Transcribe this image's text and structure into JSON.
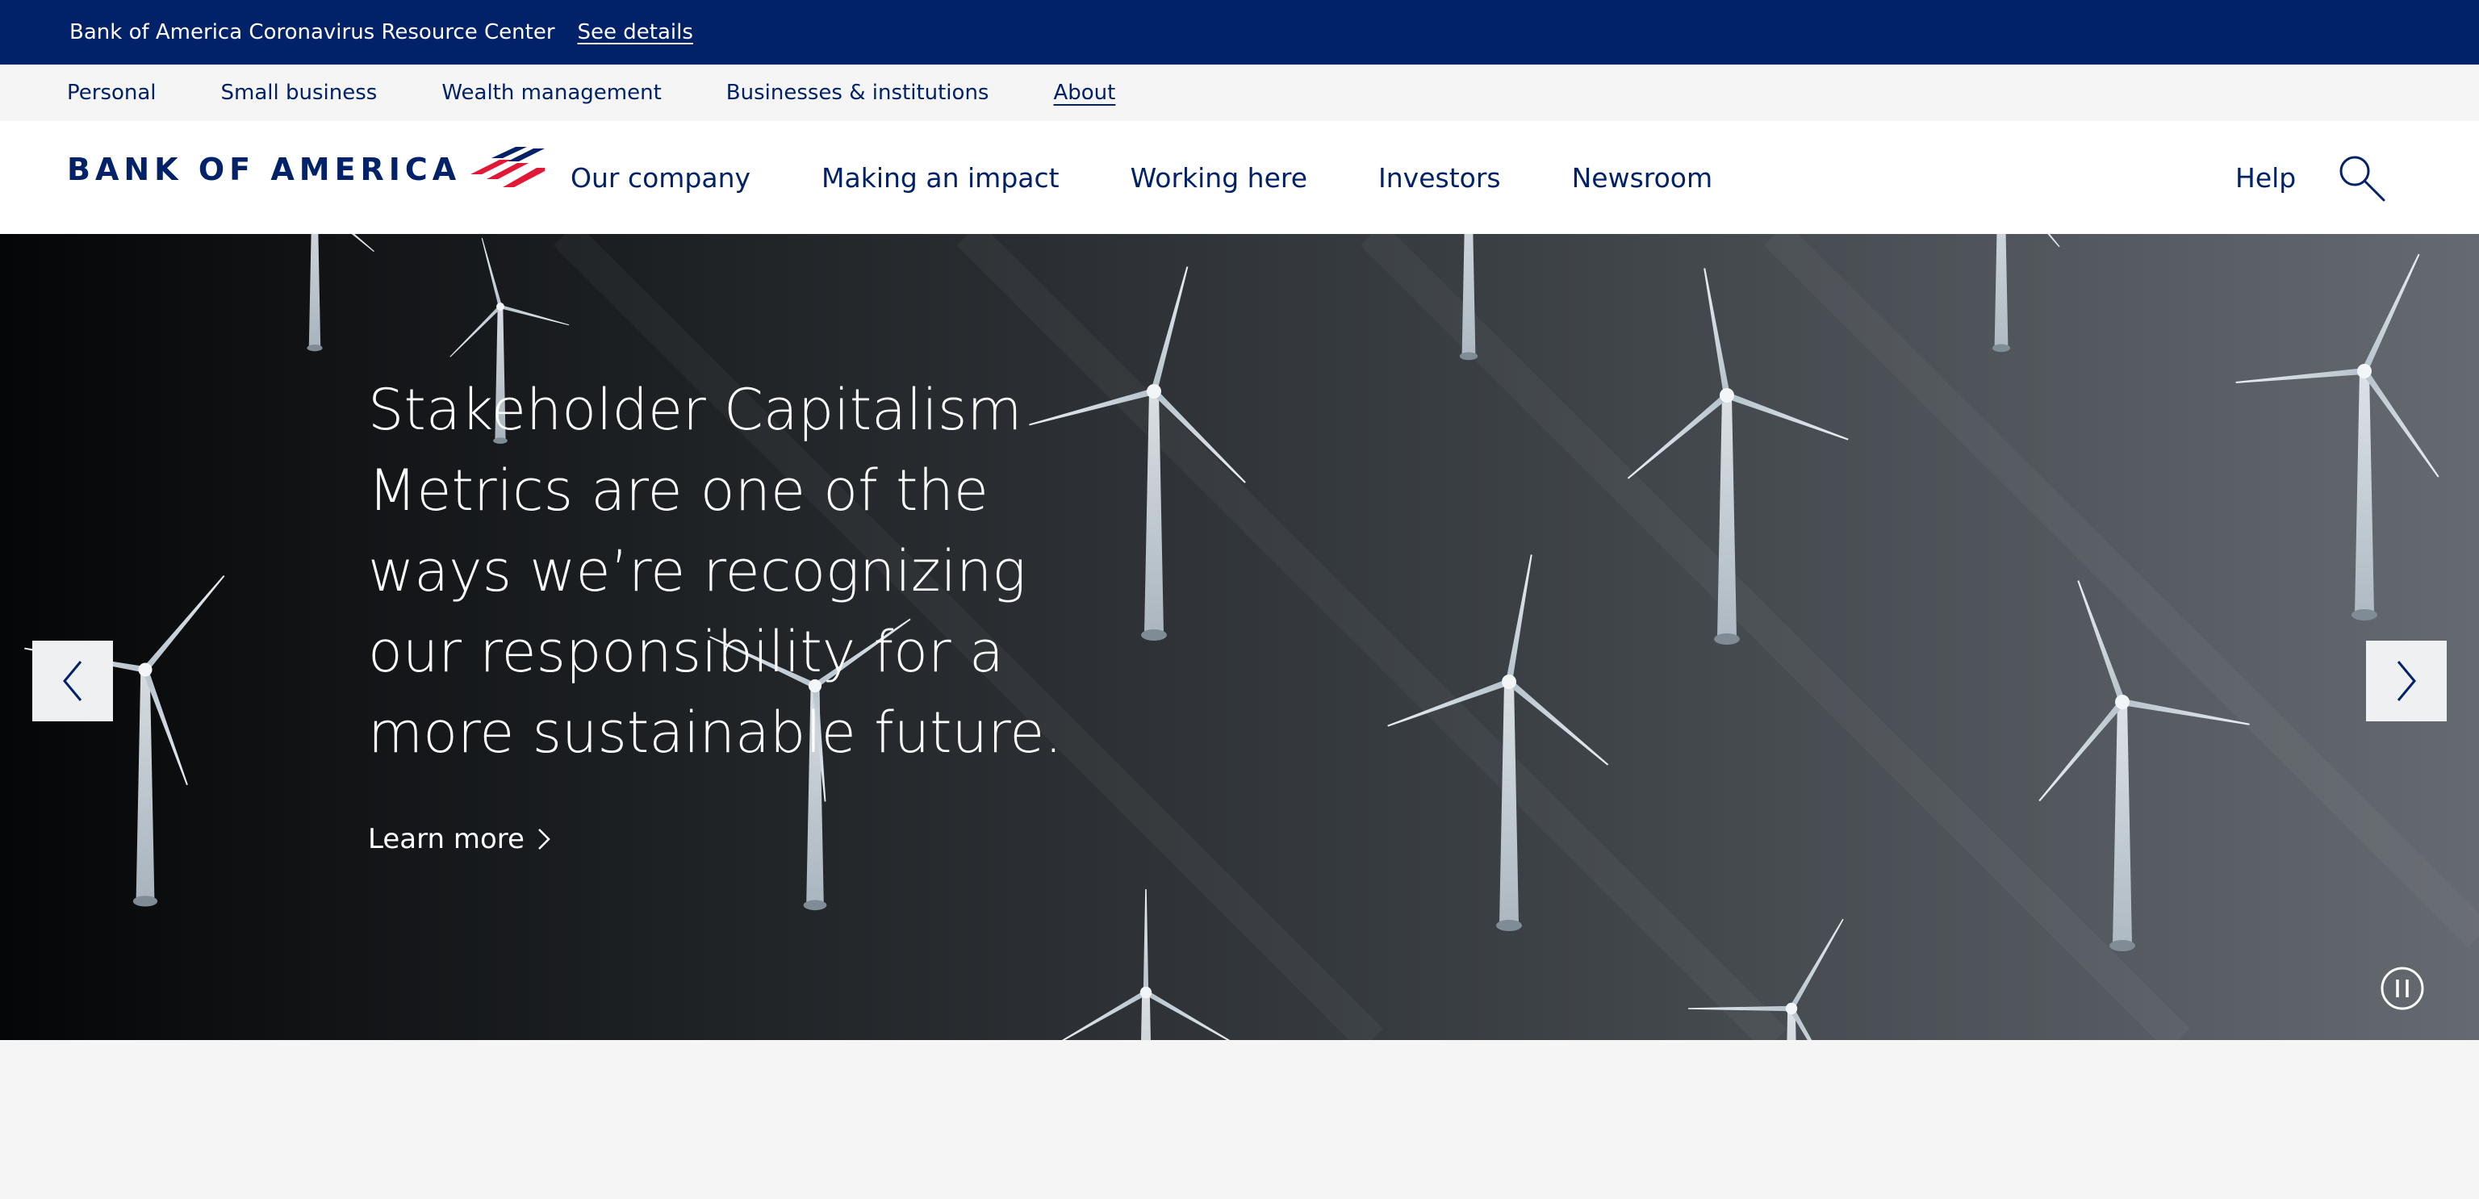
{
  "notice": {
    "text": "Bank of America Coronavirus Resource Center",
    "link": "See details"
  },
  "segments": [
    {
      "label": "Personal"
    },
    {
      "label": "Small business"
    },
    {
      "label": "Wealth management"
    },
    {
      "label": "Businesses & institutions"
    },
    {
      "label": "About",
      "active": true
    }
  ],
  "header": {
    "logo_text": "BANK OF AMERICA",
    "nav": [
      {
        "label": "Our company"
      },
      {
        "label": "Making an impact"
      },
      {
        "label": "Working here"
      },
      {
        "label": "Investors"
      },
      {
        "label": "Newsroom"
      }
    ],
    "help": "Help",
    "search_icon": "search-icon"
  },
  "hero": {
    "headline_lines": [
      "Stakeholder Capitalism",
      "Metrics are one of the",
      "ways we’re recognizing",
      "our responsibility for a",
      "more sustainable future."
    ],
    "cta": "Learn more",
    "prev_icon": "chevron-left-icon",
    "next_icon": "chevron-right-icon",
    "pause_icon": "pause-icon"
  },
  "colors": {
    "brand_navy": "#012169",
    "brand_red": "#e31837",
    "light_gray": "#f5f5f5"
  }
}
